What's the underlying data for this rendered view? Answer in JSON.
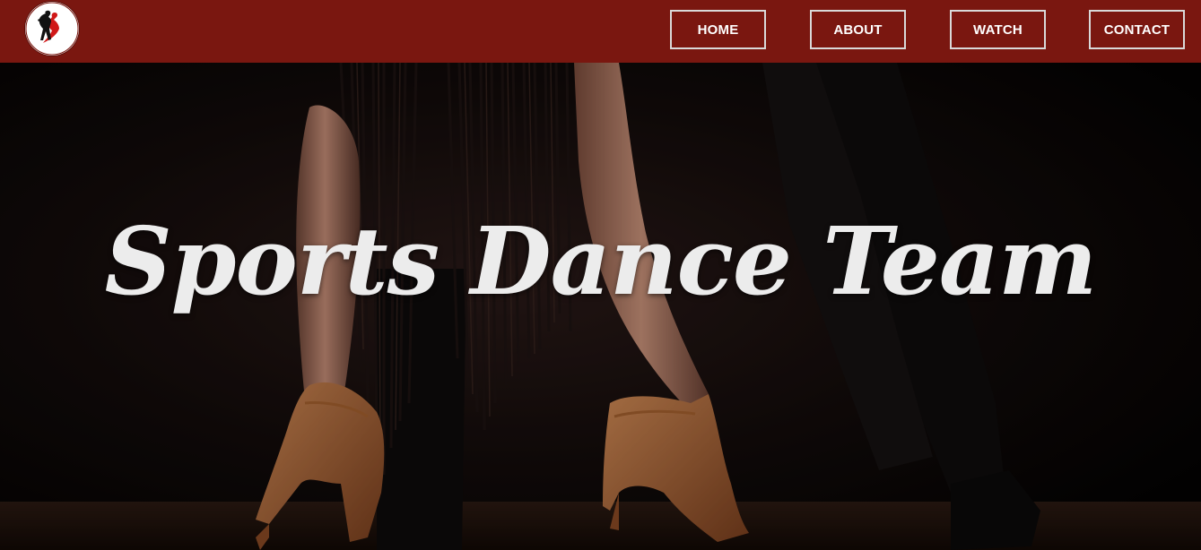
{
  "header": {
    "logo_icon": "dancing-couple-logo-icon",
    "bar_color": "#7a1710",
    "nav": {
      "home": "HOME",
      "about": "ABOUT",
      "watch": "WATCH",
      "contact": "CONTACT"
    }
  },
  "hero": {
    "title": "Sports Dance Team",
    "title_color": "#ececec",
    "background_image": "dancers-legs-photo"
  }
}
